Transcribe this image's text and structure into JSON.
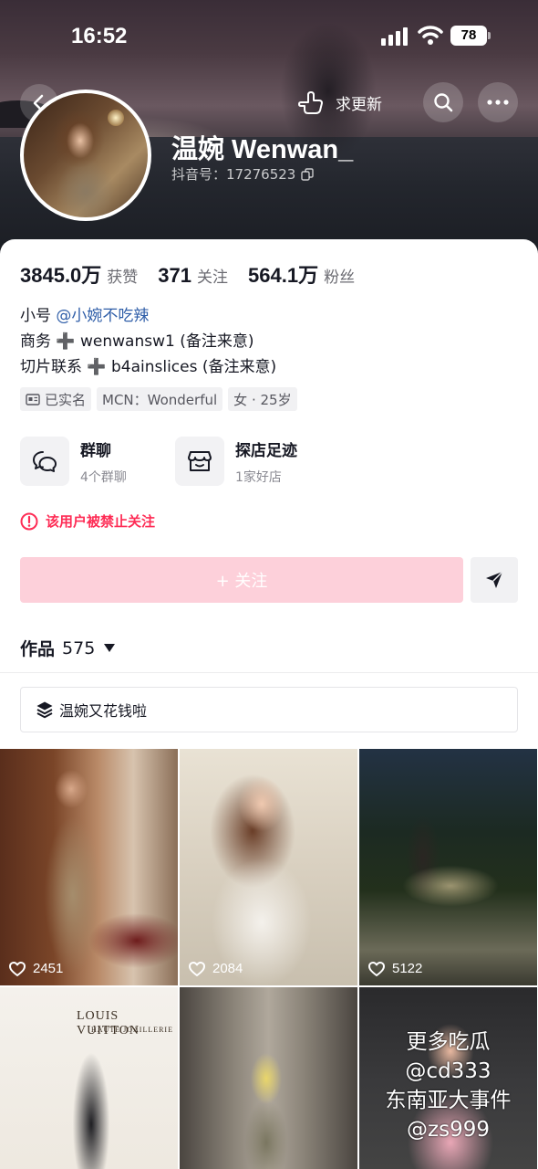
{
  "status_bar": {
    "time": "16:52",
    "battery": "78"
  },
  "header": {
    "refresh_label": "求更新",
    "display_name": "温婉 Wenwan_",
    "douyin_id": "抖音号：17276523"
  },
  "stats": [
    {
      "num": "3845.0万",
      "label": "获赞"
    },
    {
      "num": "371",
      "label": "关注"
    },
    {
      "num": "564.1万",
      "label": "粉丝"
    }
  ],
  "bio": {
    "line1_prefix": "小号 ",
    "line1_mention": "@小婉不吃辣",
    "line2_prefix": "商务 ",
    "line2_plus": "➕",
    "line2_suffix": " wenwansw1 (备注来意)",
    "line3_prefix": "切片联系 ",
    "line3_plus": "➕",
    "line3_suffix": "  b4ainslices (备注来意)"
  },
  "tags": [
    "已实名",
    "MCN：Wonderful",
    "女 · 25岁"
  ],
  "features": {
    "group": {
      "title": "群聊",
      "sub": "4个群聊"
    },
    "shop": {
      "title": "探店足迹",
      "sub": "1家好店"
    }
  },
  "ban_notice": "该用户被禁止关注",
  "follow_label": "+ 关注",
  "works": {
    "label": "作品",
    "count": "575"
  },
  "collection_label": "温婉又花钱啦",
  "videos": [
    {
      "likes": "2451"
    },
    {
      "likes": "2084"
    },
    {
      "likes": "5122"
    },
    {
      "likes": ""
    },
    {
      "likes": ""
    },
    {
      "likes": ""
    }
  ],
  "video4_brand": "LOUIS VUITTON",
  "video4_sub": "HAUTE JOAILLERIE",
  "video6_promo": [
    "更多吃瓜",
    "@cd333",
    "东南亚大事件",
    "@zs999"
  ],
  "colors": {
    "accent": "#fe2c55",
    "follow_disabled": "#fdd0da",
    "mention": "#2f5ea8"
  },
  "icons": [
    "back-icon",
    "hand-point-icon",
    "search-icon",
    "more-icon",
    "copy-icon",
    "id-card-icon",
    "chat-bubble-icon",
    "shop-icon",
    "warning-icon",
    "send-icon",
    "caret-down-icon",
    "layers-icon",
    "heart-icon"
  ]
}
